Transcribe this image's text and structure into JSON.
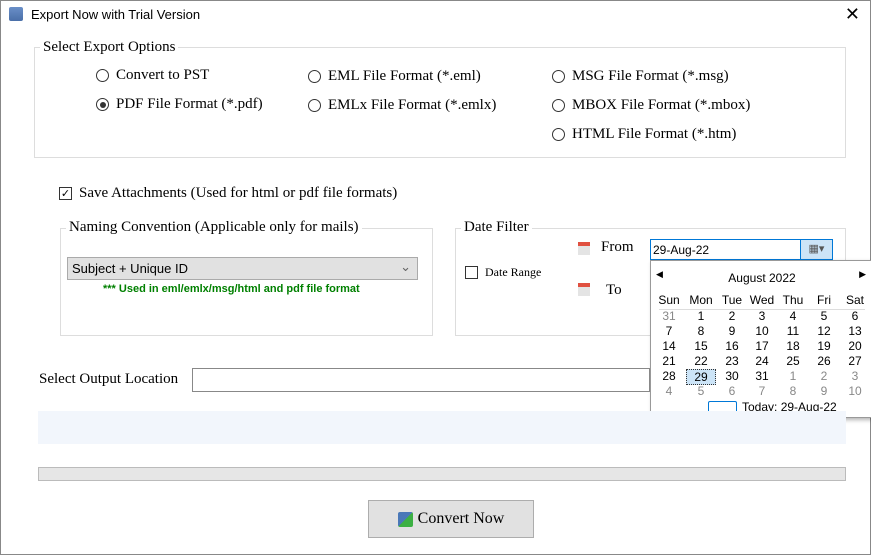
{
  "window": {
    "title": "Export Now with Trial Version",
    "close": "✕"
  },
  "export_options": {
    "label": "Select Export Options",
    "options": [
      {
        "label": "Convert to PST",
        "selected": false
      },
      {
        "label": "PDF File Format (*.pdf)",
        "selected": true
      },
      {
        "label": "EML File  Format (*.eml)",
        "selected": false
      },
      {
        "label": "EMLx File  Format (*.emlx)",
        "selected": false
      },
      {
        "label": "MSG File Format (*.msg)",
        "selected": false
      },
      {
        "label": "MBOX File Format (*.mbox)",
        "selected": false
      },
      {
        "label": "HTML File  Format (*.htm)",
        "selected": false
      }
    ]
  },
  "save_attachments": {
    "label": "Save Attachments (Used for html or pdf file formats)",
    "checked": true
  },
  "naming": {
    "label": "Naming Convention (Applicable only for mails)",
    "value": "Subject + Unique ID",
    "note": "*** Used in eml/emlx/msg/html and pdf file format",
    "note_color": "#008000"
  },
  "date_filter": {
    "label": "Date Filter",
    "date_range_label": "Date Range",
    "date_range_checked": false,
    "from_label": "From",
    "to_label": "To",
    "from_value": "29-Aug-22"
  },
  "calendar": {
    "month": "August 2022",
    "days": [
      "Sun",
      "Mon",
      "Tue",
      "Wed",
      "Thu",
      "Fri",
      "Sat"
    ],
    "weeks": [
      [
        31,
        1,
        2,
        3,
        4,
        5,
        6
      ],
      [
        7,
        8,
        9,
        10,
        11,
        12,
        13
      ],
      [
        14,
        15,
        16,
        17,
        18,
        19,
        20
      ],
      [
        21,
        22,
        23,
        24,
        25,
        26,
        27
      ],
      [
        28,
        29,
        30,
        31,
        1,
        2,
        3
      ],
      [
        4,
        5,
        6,
        7,
        8,
        9,
        10
      ]
    ],
    "selected": 29,
    "today": "Today: 29-Aug-22"
  },
  "output": {
    "label": "Select Output Location",
    "value": ""
  },
  "progress": 0,
  "convert_button": "Convert Now"
}
